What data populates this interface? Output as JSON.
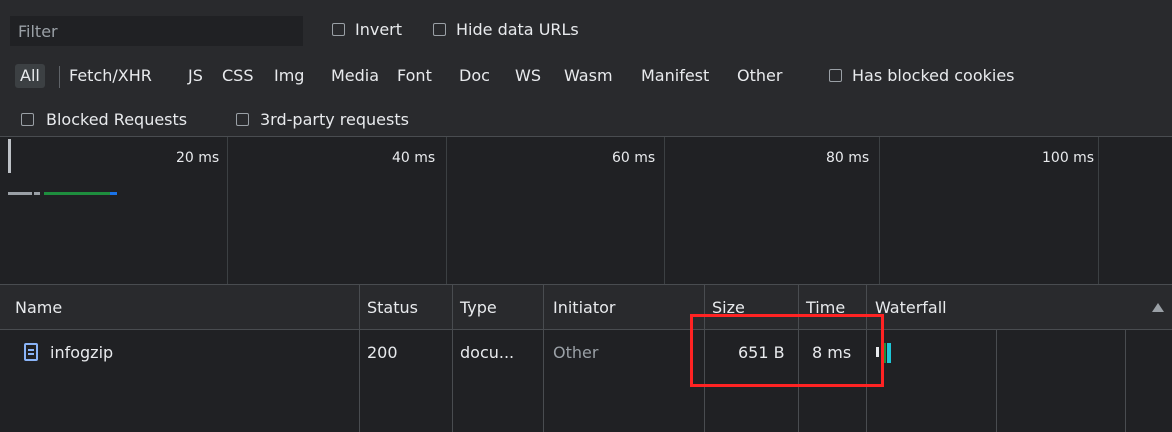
{
  "toolbar": {
    "filter_placeholder": "Filter",
    "invert_label": "Invert",
    "hide_data_urls_label": "Hide data URLs",
    "types": [
      "All",
      "Fetch/XHR",
      "JS",
      "CSS",
      "Img",
      "Media",
      "Font",
      "Doc",
      "WS",
      "Wasm",
      "Manifest",
      "Other"
    ],
    "selected_type": "All",
    "has_blocked_cookies_label": "Has blocked cookies",
    "blocked_requests_label": "Blocked Requests",
    "third_party_label": "3rd-party requests"
  },
  "overview": {
    "ticks": [
      "20 ms",
      "40 ms",
      "60 ms",
      "80 ms",
      "100 ms"
    ],
    "bar_colors": {
      "queue": "#9aa0a6",
      "waiting": "#1e8e3e",
      "download": "#1a73e8"
    }
  },
  "table": {
    "columns": [
      "Name",
      "Status",
      "Type",
      "Initiator",
      "Size",
      "Time",
      "Waterfall"
    ],
    "rows": [
      {
        "name": "infogzip",
        "icon": "document-icon",
        "status": "200",
        "type": "docu...",
        "initiator": "Other",
        "size": "651 B",
        "time": "8 ms"
      }
    ]
  }
}
